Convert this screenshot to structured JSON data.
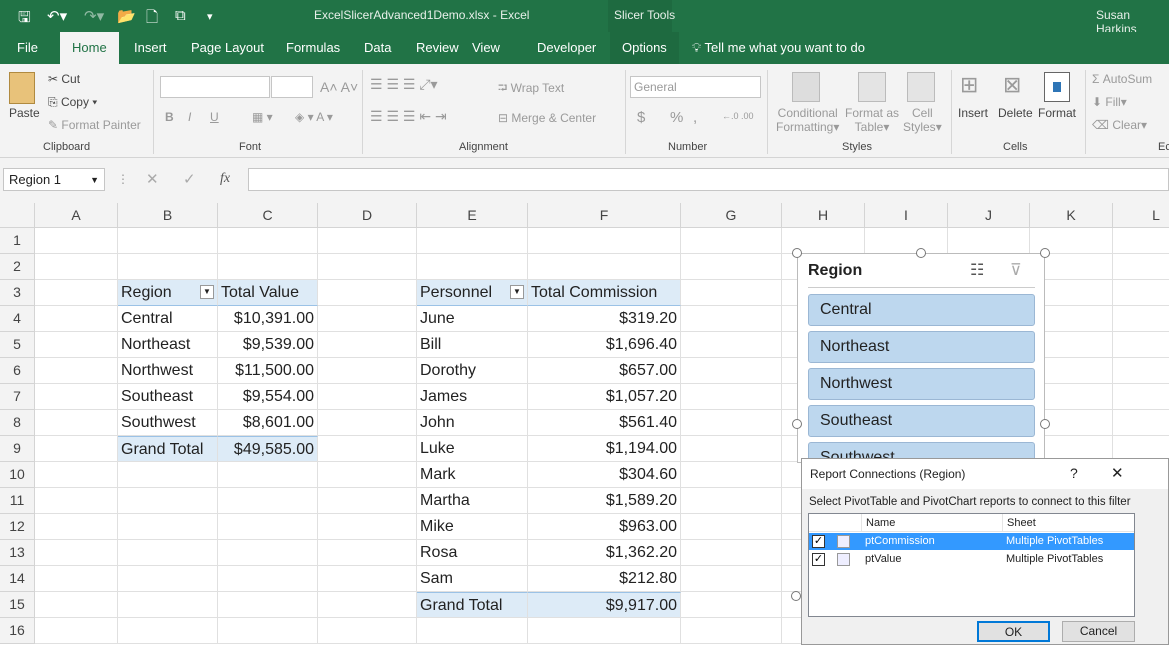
{
  "window": {
    "title": "ExcelSlicerAdvanced1Demo.xlsx - Excel",
    "context_tab": "Slicer Tools",
    "user": "Susan Harkins"
  },
  "tabs": [
    "File",
    "Home",
    "Insert",
    "Page Layout",
    "Formulas",
    "Data",
    "Review",
    "View",
    "Developer",
    "Options"
  ],
  "tell_me": "Tell me what you want to do",
  "ribbon": {
    "clipboard": {
      "paste": "Paste",
      "cut": "Cut",
      "copy": "Copy",
      "format_painter": "Format Painter",
      "label": "Clipboard"
    },
    "font": {
      "bold": "B",
      "italic": "I",
      "underline": "U",
      "label": "Font"
    },
    "alignment": {
      "wrap": "Wrap Text",
      "merge": "Merge & Center",
      "label": "Alignment"
    },
    "number": {
      "format": "General",
      "currency": "$",
      "percent": "%",
      "comma": ",",
      "label": "Number"
    },
    "styles": {
      "conditional": "Conditional",
      "conditional2": "Formatting",
      "format_as": "Format as",
      "format_as2": "Table",
      "cell": "Cell",
      "cell2": "Styles",
      "label": "Styles"
    },
    "cells": {
      "insert": "Insert",
      "delete": "Delete",
      "format": "Format",
      "label": "Cells"
    },
    "editing": {
      "autosum": "AutoSum",
      "fill": "Fill",
      "clear": "Clear",
      "label": "Ec"
    }
  },
  "formula_bar": {
    "name_box": "Region 1",
    "fx": "fx",
    "value": ""
  },
  "columns": [
    "A",
    "B",
    "C",
    "D",
    "E",
    "F",
    "G",
    "H",
    "I",
    "J",
    "K",
    "L"
  ],
  "rows": [
    "1",
    "2",
    "3",
    "4",
    "5",
    "6",
    "7",
    "8",
    "9",
    "10",
    "11",
    "12",
    "13",
    "14",
    "15",
    "16"
  ],
  "pivot_value": {
    "headers": [
      "Region",
      "Total Value"
    ],
    "rows": [
      [
        "Central",
        "$10,391.00"
      ],
      [
        "Northeast",
        "$9,539.00"
      ],
      [
        "Northwest",
        "$11,500.00"
      ],
      [
        "Southeast",
        "$9,554.00"
      ],
      [
        "Southwest",
        "$8,601.00"
      ]
    ],
    "total": [
      "Grand Total",
      "$49,585.00"
    ]
  },
  "pivot_commission": {
    "headers": [
      "Personnel",
      "Total Commission"
    ],
    "rows": [
      [
        "June",
        "$319.20"
      ],
      [
        "Bill",
        "$1,696.40"
      ],
      [
        "Dorothy",
        "$657.00"
      ],
      [
        "James",
        "$1,057.20"
      ],
      [
        "John",
        "$561.40"
      ],
      [
        "Luke",
        "$1,194.00"
      ],
      [
        "Mark",
        "$304.60"
      ],
      [
        "Martha",
        "$1,589.20"
      ],
      [
        "Mike",
        "$963.00"
      ],
      [
        "Rosa",
        "$1,362.20"
      ],
      [
        "Sam",
        "$212.80"
      ]
    ],
    "total": [
      "Grand Total",
      "$9,917.00"
    ]
  },
  "slicer": {
    "title": "Region",
    "items": [
      "Central",
      "Northeast",
      "Northwest",
      "Southeast",
      "Southwest"
    ]
  },
  "dialog": {
    "title": "Report Connections (Region)",
    "help": "?",
    "close": "✕",
    "instruction": "Select PivotTable and PivotChart reports to connect to this filter",
    "columns": [
      "Name",
      "Sheet"
    ],
    "items": [
      {
        "name": "ptCommission",
        "sheet": "Multiple PivotTables",
        "checked": true,
        "selected": true
      },
      {
        "name": "ptValue",
        "sheet": "Multiple PivotTables",
        "checked": true,
        "selected": false
      }
    ],
    "ok": "OK",
    "cancel": "Cancel"
  },
  "colors": {
    "excel_green": "#217346",
    "pivot_header": "#ddebf7",
    "slicer_item": "#bdd7ee",
    "selection": "#3399ff"
  }
}
